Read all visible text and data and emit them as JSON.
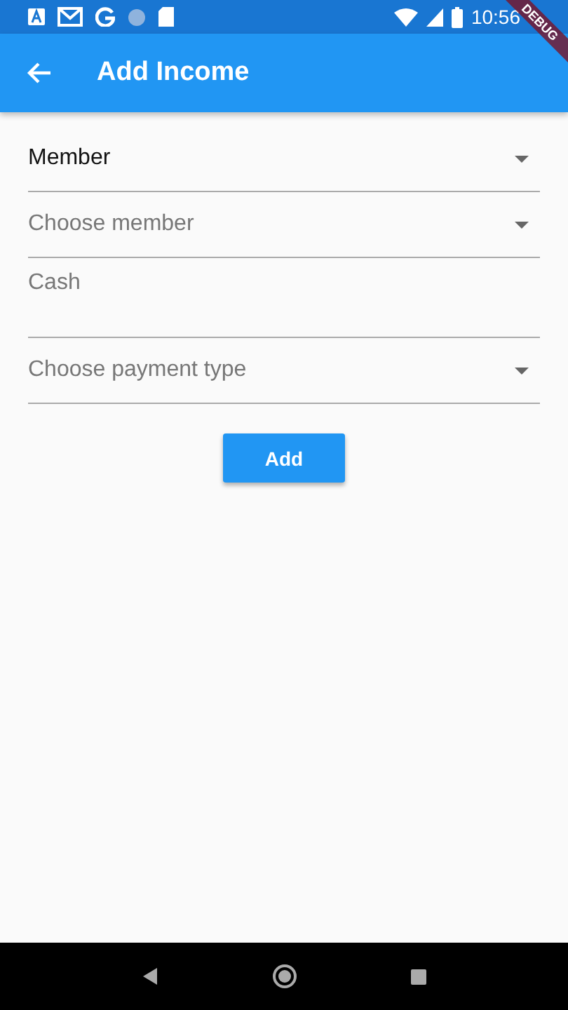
{
  "status_bar": {
    "time": "10:56"
  },
  "debug_banner": {
    "label": "DEBUG"
  },
  "app_bar": {
    "title": "Add Income"
  },
  "fields": [
    {
      "kind": "dropdown",
      "value": "Member"
    },
    {
      "kind": "dropdown",
      "placeholder": "Choose member"
    },
    {
      "kind": "text",
      "placeholder": "Cash"
    },
    {
      "kind": "dropdown",
      "placeholder": "Choose payment type"
    }
  ],
  "submit_button": {
    "label": "Add"
  }
}
